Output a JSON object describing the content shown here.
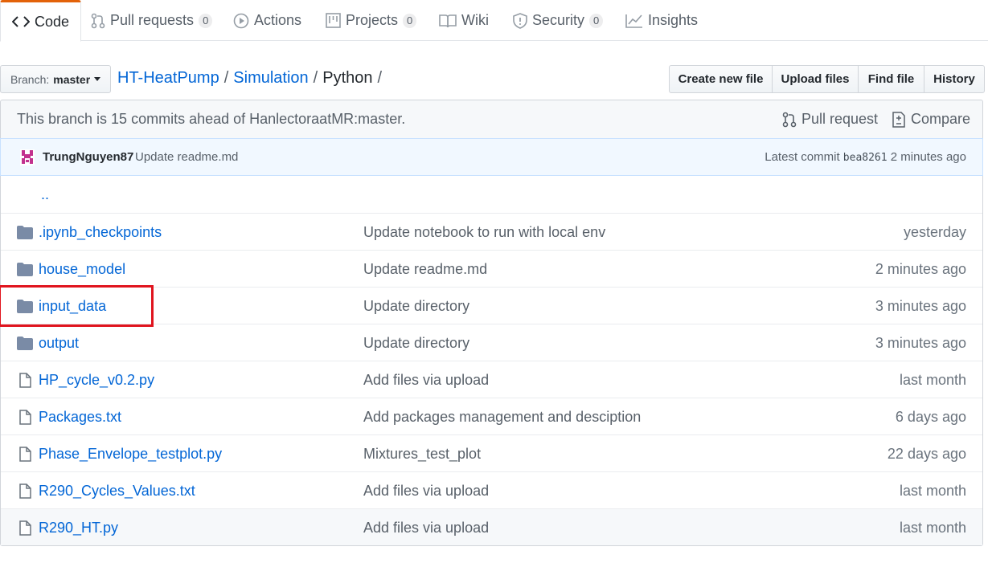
{
  "tabs": [
    {
      "label": "Code",
      "icon": "code-icon",
      "selected": true
    },
    {
      "label": "Pull requests",
      "icon": "pull-request-icon",
      "count": "0"
    },
    {
      "label": "Actions",
      "icon": "play-icon"
    },
    {
      "label": "Projects",
      "icon": "project-icon",
      "count": "0"
    },
    {
      "label": "Wiki",
      "icon": "book-icon"
    },
    {
      "label": "Security",
      "icon": "shield-icon",
      "count": "0"
    },
    {
      "label": "Insights",
      "icon": "graph-icon"
    }
  ],
  "branch": {
    "prefix": "Branch:",
    "name": "master"
  },
  "breadcrumb": {
    "repo": "HT-HeatPump",
    "dir1": "Simulation",
    "current": "Python",
    "sep": "/"
  },
  "file_buttons": [
    "Create new file",
    "Upload files",
    "Find file",
    "History"
  ],
  "branch_info": {
    "message": "This branch is 15 commits ahead of HanlectoraatMR:master.",
    "pull_request_label": "Pull request",
    "compare_label": "Compare"
  },
  "latest_commit": {
    "author": "TrungNguyen87",
    "message": "Update readme.md",
    "prefix": "Latest commit",
    "sha": "bea8261",
    "age": "2 minutes ago"
  },
  "updir": "..",
  "files": [
    {
      "type": "dir",
      "name": ".ipynb_checkpoints",
      "message": "Update notebook to run with local env",
      "age": "yesterday"
    },
    {
      "type": "dir",
      "name": "house_model",
      "message": "Update readme.md",
      "age": "2 minutes ago"
    },
    {
      "type": "dir",
      "name": "input_data",
      "message": "Update directory",
      "age": "3 minutes ago"
    },
    {
      "type": "dir",
      "name": "output",
      "message": "Update directory",
      "age": "3 minutes ago"
    },
    {
      "type": "file",
      "name": "HP_cycle_v0.2.py",
      "message": "Add files via upload",
      "age": "last month"
    },
    {
      "type": "file",
      "name": "Packages.txt",
      "message": "Add packages management and desciption",
      "age": "6 days ago"
    },
    {
      "type": "file",
      "name": "Phase_Envelope_testplot.py",
      "message": "Mixtures_test_plot",
      "age": "22 days ago"
    },
    {
      "type": "file",
      "name": "R290_Cycles_Values.txt",
      "message": "Add files via upload",
      "age": "last month"
    },
    {
      "type": "file",
      "name": "R290_HT.py",
      "message": "Add files via upload",
      "age": "last month"
    }
  ],
  "colors": {
    "link": "#0366d6",
    "tab_accent": "#e36209",
    "highlight": "#e0141e",
    "folder": "#79b8ff"
  }
}
